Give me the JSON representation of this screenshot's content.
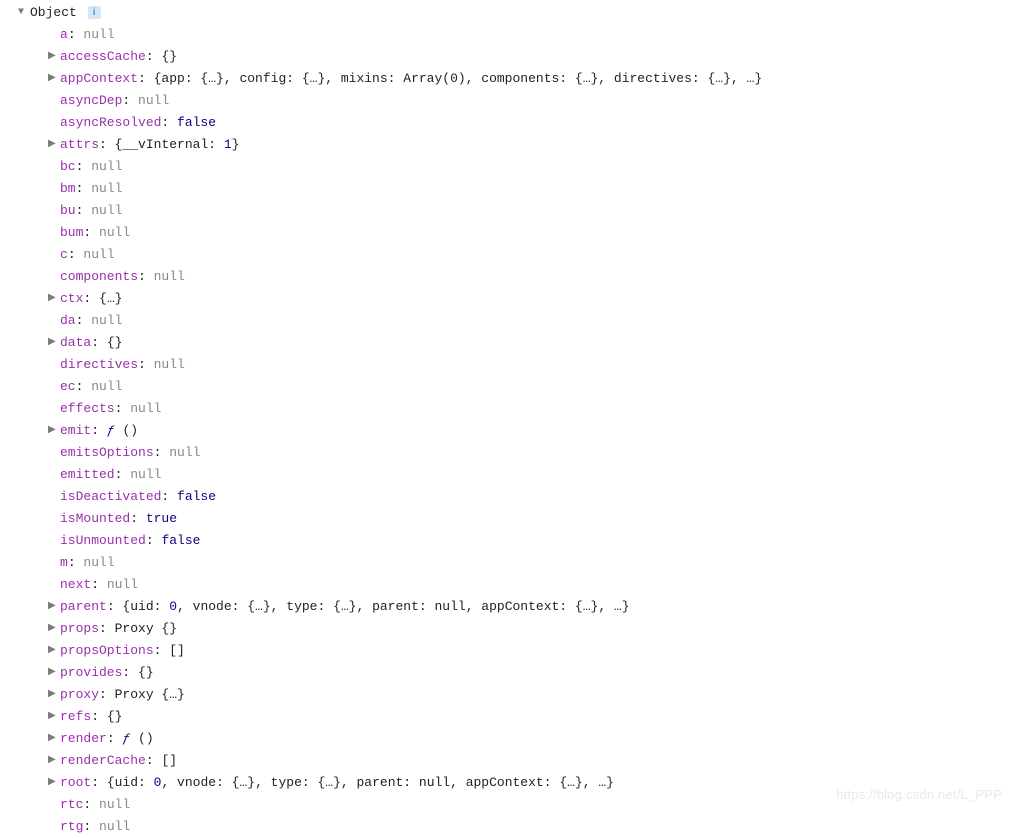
{
  "root": {
    "arrow": "▼",
    "label": "Object",
    "info": "i"
  },
  "props": [
    {
      "arrow": "",
      "keyText": "a",
      "sep": ": ",
      "valParts": [
        {
          "t": "gray",
          "s": "null"
        }
      ]
    },
    {
      "arrow": "▶",
      "keyText": "accessCache",
      "sep": ": ",
      "valParts": [
        {
          "t": "val",
          "s": "{}"
        }
      ]
    },
    {
      "arrow": "▶",
      "keyText": "appContext",
      "sep": ": ",
      "valParts": [
        {
          "t": "val",
          "s": "{app: {…}, config: {…}, mixins: Array(0), components: {…}, directives: {…}, …}"
        }
      ]
    },
    {
      "arrow": "",
      "keyText": "asyncDep",
      "sep": ": ",
      "valParts": [
        {
          "t": "gray",
          "s": "null"
        }
      ]
    },
    {
      "arrow": "",
      "keyText": "asyncResolved",
      "sep": ": ",
      "valParts": [
        {
          "t": "kw",
          "s": "false"
        }
      ]
    },
    {
      "arrow": "▶",
      "keyText": "attrs",
      "sep": ": ",
      "valParts": [
        {
          "t": "val",
          "s": "{__vInternal: "
        },
        {
          "t": "num",
          "s": "1"
        },
        {
          "t": "val",
          "s": "}"
        }
      ]
    },
    {
      "arrow": "",
      "keyText": "bc",
      "sep": ": ",
      "valParts": [
        {
          "t": "gray",
          "s": "null"
        }
      ]
    },
    {
      "arrow": "",
      "keyText": "bm",
      "sep": ": ",
      "valParts": [
        {
          "t": "gray",
          "s": "null"
        }
      ]
    },
    {
      "arrow": "",
      "keyText": "bu",
      "sep": ": ",
      "valParts": [
        {
          "t": "gray",
          "s": "null"
        }
      ]
    },
    {
      "arrow": "",
      "keyText": "bum",
      "sep": ": ",
      "valParts": [
        {
          "t": "gray",
          "s": "null"
        }
      ]
    },
    {
      "arrow": "",
      "keyText": "c",
      "sep": ": ",
      "valParts": [
        {
          "t": "gray",
          "s": "null"
        }
      ]
    },
    {
      "arrow": "",
      "keyText": "components",
      "sep": ": ",
      "valParts": [
        {
          "t": "gray",
          "s": "null"
        }
      ]
    },
    {
      "arrow": "▶",
      "keyText": "ctx",
      "sep": ": ",
      "valParts": [
        {
          "t": "val",
          "s": "{…}"
        }
      ]
    },
    {
      "arrow": "",
      "keyText": "da",
      "sep": ": ",
      "valParts": [
        {
          "t": "gray",
          "s": "null"
        }
      ]
    },
    {
      "arrow": "▶",
      "keyText": "data",
      "sep": ": ",
      "valParts": [
        {
          "t": "val",
          "s": "{}"
        }
      ]
    },
    {
      "arrow": "",
      "keyText": "directives",
      "sep": ": ",
      "valParts": [
        {
          "t": "gray",
          "s": "null"
        }
      ]
    },
    {
      "arrow": "",
      "keyText": "ec",
      "sep": ": ",
      "valParts": [
        {
          "t": "gray",
          "s": "null"
        }
      ]
    },
    {
      "arrow": "",
      "keyText": "effects",
      "sep": ": ",
      "valParts": [
        {
          "t": "gray",
          "s": "null"
        }
      ]
    },
    {
      "arrow": "▶",
      "keyText": "emit",
      "sep": ": ",
      "valParts": [
        {
          "t": "func-f",
          "s": "ƒ "
        },
        {
          "t": "val",
          "s": "()"
        }
      ]
    },
    {
      "arrow": "",
      "keyText": "emitsOptions",
      "sep": ": ",
      "valParts": [
        {
          "t": "gray",
          "s": "null"
        }
      ]
    },
    {
      "arrow": "",
      "keyText": "emitted",
      "sep": ": ",
      "valParts": [
        {
          "t": "gray",
          "s": "null"
        }
      ]
    },
    {
      "arrow": "",
      "keyText": "isDeactivated",
      "sep": ": ",
      "valParts": [
        {
          "t": "kw",
          "s": "false"
        }
      ]
    },
    {
      "arrow": "",
      "keyText": "isMounted",
      "sep": ": ",
      "valParts": [
        {
          "t": "kw",
          "s": "true"
        }
      ]
    },
    {
      "arrow": "",
      "keyText": "isUnmounted",
      "sep": ": ",
      "valParts": [
        {
          "t": "kw",
          "s": "false"
        }
      ]
    },
    {
      "arrow": "",
      "keyText": "m",
      "sep": ": ",
      "valParts": [
        {
          "t": "gray",
          "s": "null"
        }
      ]
    },
    {
      "arrow": "",
      "keyText": "next",
      "sep": ": ",
      "valParts": [
        {
          "t": "gray",
          "s": "null"
        }
      ]
    },
    {
      "arrow": "▶",
      "keyText": "parent",
      "sep": ": ",
      "valParts": [
        {
          "t": "val",
          "s": "{uid: "
        },
        {
          "t": "num",
          "s": "0"
        },
        {
          "t": "val",
          "s": ", vnode: {…}, type: {…}, parent: null, appContext: {…}, …}"
        }
      ]
    },
    {
      "arrow": "▶",
      "keyText": "props",
      "sep": ": ",
      "valParts": [
        {
          "t": "val",
          "s": "Proxy {}"
        }
      ]
    },
    {
      "arrow": "▶",
      "keyText": "propsOptions",
      "sep": ": ",
      "valParts": [
        {
          "t": "val",
          "s": "[]"
        }
      ]
    },
    {
      "arrow": "▶",
      "keyText": "provides",
      "sep": ": ",
      "valParts": [
        {
          "t": "val",
          "s": "{}"
        }
      ]
    },
    {
      "arrow": "▶",
      "keyText": "proxy",
      "sep": ": ",
      "valParts": [
        {
          "t": "val",
          "s": "Proxy {…}"
        }
      ]
    },
    {
      "arrow": "▶",
      "keyText": "refs",
      "sep": ": ",
      "valParts": [
        {
          "t": "val",
          "s": "{}"
        }
      ]
    },
    {
      "arrow": "▶",
      "keyText": "render",
      "sep": ": ",
      "valParts": [
        {
          "t": "func-f",
          "s": "ƒ "
        },
        {
          "t": "val",
          "s": "()"
        }
      ]
    },
    {
      "arrow": "▶",
      "keyText": "renderCache",
      "sep": ": ",
      "valParts": [
        {
          "t": "val",
          "s": "[]"
        }
      ]
    },
    {
      "arrow": "▶",
      "keyText": "root",
      "sep": ": ",
      "valParts": [
        {
          "t": "val",
          "s": "{uid: "
        },
        {
          "t": "num",
          "s": "0"
        },
        {
          "t": "val",
          "s": ", vnode: {…}, type: {…}, parent: null, appContext: {…}, …}"
        }
      ]
    },
    {
      "arrow": "",
      "keyText": "rtc",
      "sep": ": ",
      "valParts": [
        {
          "t": "gray",
          "s": "null"
        }
      ]
    },
    {
      "arrow": "",
      "keyText": "rtg",
      "sep": ": ",
      "valParts": [
        {
          "t": "gray",
          "s": "null"
        }
      ]
    }
  ],
  "watermark": "https://blog.csdn.net/L_PPP"
}
